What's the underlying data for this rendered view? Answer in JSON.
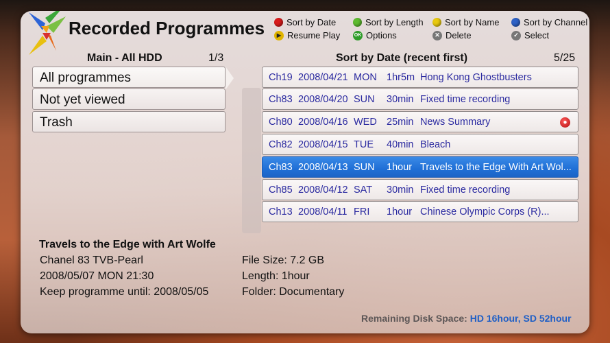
{
  "header": {
    "title": "Recorded Programmes"
  },
  "legend": {
    "sort_date": "Sort by Date",
    "sort_length": "Sort by Length",
    "sort_name": "Sort by Name",
    "sort_channel": "Sort by Channel",
    "resume_play": "Resume Play",
    "options": "Options",
    "delete": "Delete",
    "select": "Select",
    "ok_glyph": "OK"
  },
  "left": {
    "header": "Main - All HDD",
    "count": "1/3",
    "items": [
      "All programmes",
      "Not yet viewed",
      "Trash"
    ]
  },
  "right": {
    "header": "Sort by Date (recent first)",
    "count": "5/25",
    "rows": [
      {
        "ch": "Ch19",
        "date": "2008/04/21",
        "day": "MON",
        "duration": "1hr5m",
        "title": "Hong Kong Ghostbusters"
      },
      {
        "ch": "Ch83",
        "date": "2008/04/20",
        "day": "SUN",
        "duration": "30min",
        "title": "Fixed time recording"
      },
      {
        "ch": "Ch80",
        "date": "2008/04/16",
        "day": "WED",
        "duration": "25min",
        "title": "News Summary"
      },
      {
        "ch": "Ch82",
        "date": "2008/04/15",
        "day": "TUE",
        "duration": "40min",
        "title": "Bleach"
      },
      {
        "ch": "Ch83",
        "date": "2008/04/13",
        "day": "SUN",
        "duration": "1hour",
        "title": "Travels to the Edge With Art Wol..."
      },
      {
        "ch": "Ch85",
        "date": "2008/04/12",
        "day": "SAT",
        "duration": "30min",
        "title": "Fixed time recording"
      },
      {
        "ch": "Ch13",
        "date": "2008/04/11",
        "day": "FRI",
        "duration": "1hour",
        "title": "Chinese Olympic Corps (R)..."
      }
    ]
  },
  "detail": {
    "title": "Travels to the Edge with Art Wolfe",
    "channel": "Chanel 83 TVB-Pearl",
    "datetime": "2008/05/07 MON 21:30",
    "keep_until": "Keep programme until: 2008/05/05",
    "file_size": "File Size: 7.2 GB",
    "length": "Length: 1hour",
    "folder": "Folder: Documentary"
  },
  "disk": {
    "label": "Remaining Disk Space:",
    "value": "HD 16hour, SD 52hour"
  },
  "colors": {
    "accent_blue": "#1f6fd6",
    "row_text": "#2b2aa0",
    "red": "#d81b1b",
    "green": "#5dbb2f",
    "yellow": "#e8c90f",
    "blue": "#2e62c6"
  },
  "icons": {
    "logo": "colorful-x-logo",
    "rec": "recording-icon"
  }
}
